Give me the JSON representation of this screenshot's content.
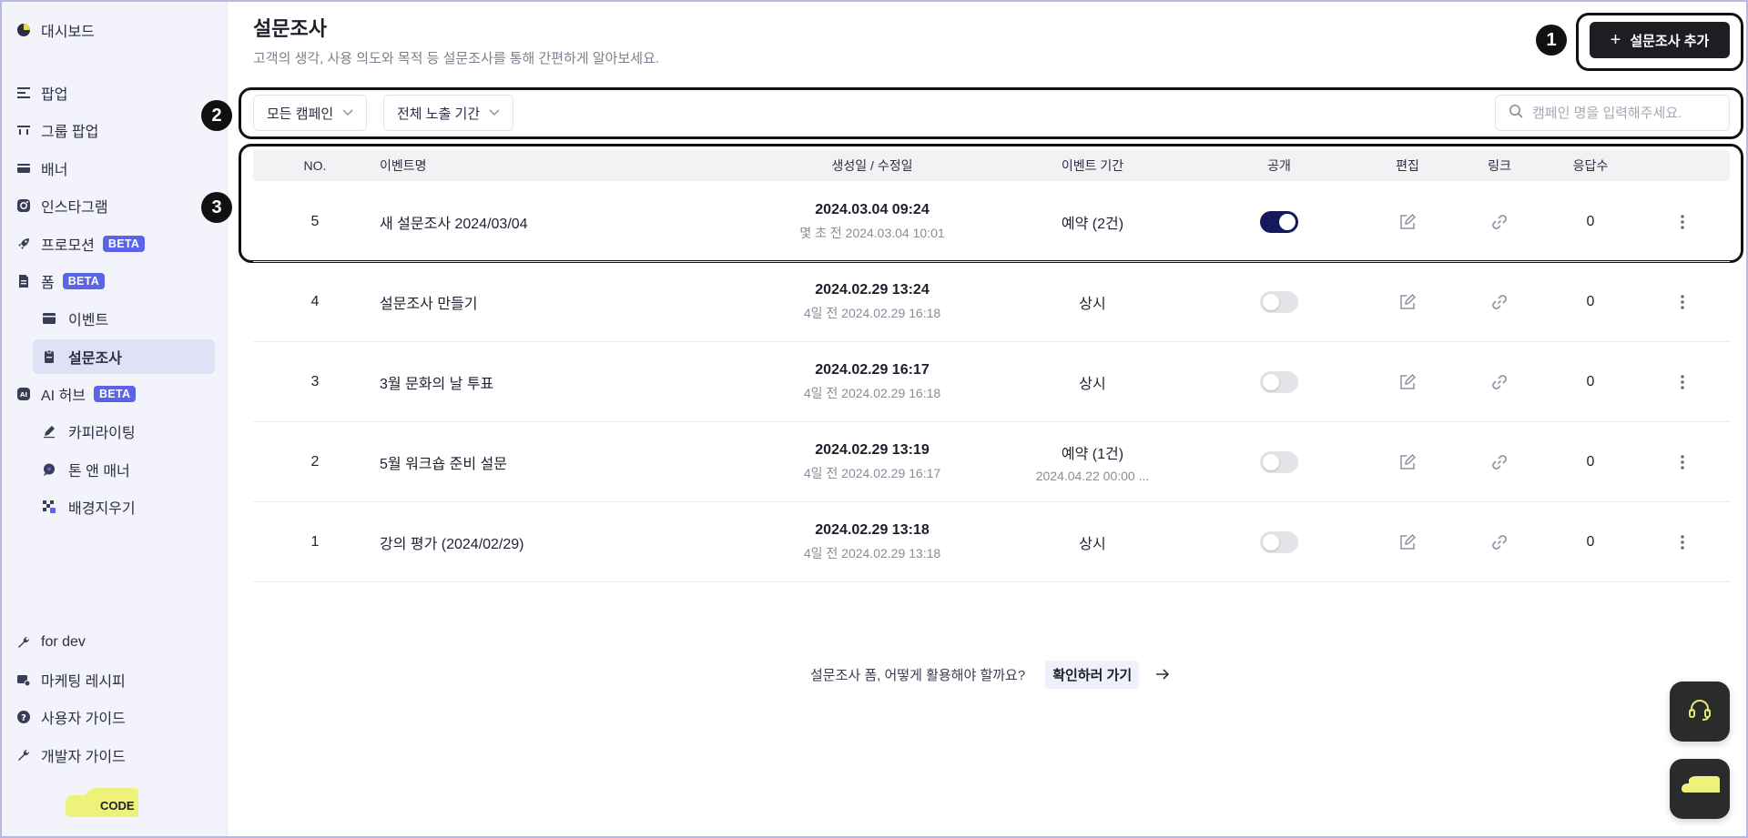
{
  "sidebar": {
    "dashboard": "대시보드",
    "items": [
      {
        "label": "팝업",
        "icon": "popup-icon"
      },
      {
        "label": "그룹 팝업",
        "icon": "group-popup-icon"
      },
      {
        "label": "배너",
        "icon": "banner-icon"
      },
      {
        "label": "인스타그램",
        "icon": "instagram-icon"
      },
      {
        "label": "프로모션",
        "icon": "rocket-icon",
        "badge": "BETA"
      },
      {
        "label": "폼",
        "icon": "form-icon",
        "badge": "BETA"
      }
    ],
    "form_sub": [
      {
        "label": "이벤트",
        "icon": "event-icon"
      },
      {
        "label": "설문조사",
        "icon": "survey-icon",
        "active": true
      }
    ],
    "ai_hub": {
      "label": "AI 허브",
      "badge": "BETA",
      "icon": "ai-icon"
    },
    "ai_sub": [
      {
        "label": "카피라이팅",
        "icon": "pen-icon"
      },
      {
        "label": "톤 앤 매너",
        "icon": "chat-icon"
      },
      {
        "label": "배경지우기",
        "icon": "bg-remove-icon"
      }
    ],
    "bottom": [
      {
        "label": "for dev",
        "icon": "wrench-icon"
      },
      {
        "label": "마케팅 레시피",
        "icon": "recipe-icon"
      },
      {
        "label": "사용자 가이드",
        "icon": "help-icon"
      },
      {
        "label": "개발자 가이드",
        "icon": "wrench-icon"
      }
    ],
    "logo_text": "CODE"
  },
  "header": {
    "title": "설문조사",
    "description": "고객의 생각, 사용 의도와 목적 등 설문조사를 통해 간편하게 알아보세요.",
    "add_button": "설문조사 추가"
  },
  "markers": [
    "1",
    "2",
    "3"
  ],
  "filters": {
    "campaign": "모든 캠페인",
    "period": "전체 노출 기간",
    "search_placeholder": "캠페인 명을 입력해주세요."
  },
  "table": {
    "headers": {
      "no": "NO.",
      "name": "이벤트명",
      "date": "생성일 / 수정일",
      "period": "이벤트 기간",
      "public": "공개",
      "edit": "편집",
      "link": "링크",
      "responses": "응답수"
    },
    "rows": [
      {
        "no": "5",
        "name": "새 설문조사 2024/03/04",
        "created": "2024.03.04 09:24",
        "modified": "몇 초 전 2024.03.04 10:01",
        "period": "예약 (2건)",
        "period_sub": "",
        "public": true,
        "responses": "0"
      },
      {
        "no": "4",
        "name": "설문조사 만들기",
        "created": "2024.02.29 13:24",
        "modified": "4일 전 2024.02.29 16:18",
        "period": "상시",
        "period_sub": "",
        "public": false,
        "responses": "0"
      },
      {
        "no": "3",
        "name": "3월 문화의 날 투표",
        "created": "2024.02.29 16:17",
        "modified": "4일 전 2024.02.29 16:18",
        "period": "상시",
        "period_sub": "",
        "public": false,
        "responses": "0"
      },
      {
        "no": "2",
        "name": "5월 워크숍 준비 설문",
        "created": "2024.02.29 13:19",
        "modified": "4일 전 2024.02.29 16:17",
        "period": "예약 (1건)",
        "period_sub": "2024.04.22 00:00 ...",
        "public": false,
        "responses": "0"
      },
      {
        "no": "1",
        "name": "강의 평가 (2024/02/29)",
        "created": "2024.02.29 13:18",
        "modified": "4일 전 2024.02.29 13:18",
        "period": "상시",
        "period_sub": "",
        "public": false,
        "responses": "0"
      }
    ]
  },
  "guide": {
    "question": "설문조사 폼, 어떻게 활용해야 할까요?",
    "link": "확인하러 가기"
  },
  "colors": {
    "accent": "#5b63e6",
    "toggle_on": "#141a5c",
    "primary_button": "#1d1d22"
  }
}
